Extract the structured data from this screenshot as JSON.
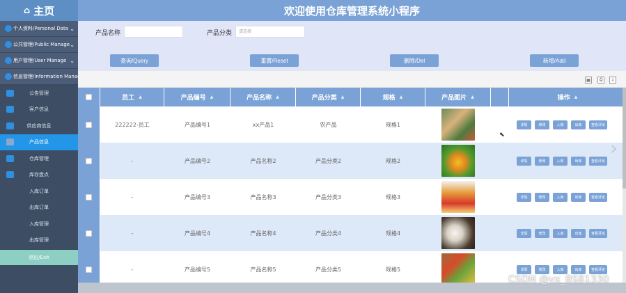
{
  "sidebar": {
    "home_label": "主页",
    "groups": [
      {
        "label": "个人资料/Personal Data"
      },
      {
        "label": "公共管理/Public Manage"
      },
      {
        "label": "用户管理/User Manage"
      },
      {
        "label": "信息管理/Information Manage"
      }
    ],
    "items": [
      {
        "label": "公告管理"
      },
      {
        "label": "客户信息"
      },
      {
        "label": "供应商信息"
      },
      {
        "label": "产品信息"
      },
      {
        "label": "仓库管理"
      },
      {
        "label": "库存盘点"
      },
      {
        "label": "入库订单"
      },
      {
        "label": "出库订单"
      },
      {
        "label": "入库管理"
      },
      {
        "label": "出库管理"
      }
    ],
    "logout_label": "退出/Exit"
  },
  "header": {
    "title": "欢迎使用仓库管理系统小程序"
  },
  "search": {
    "name_label": "产品名称",
    "name_value": "",
    "category_label": "产品分类",
    "category_placeholder": "请选择",
    "buttons": {
      "query": "查询/Query",
      "reset": "重置/Reset",
      "del": "删除/Del",
      "add": "新增/Add"
    }
  },
  "toolbar": {
    "icons": [
      "columns-icon",
      "print-icon",
      "export-icon"
    ]
  },
  "table": {
    "headers": {
      "employee": "员工",
      "code": "产品编号",
      "name": "产品名称",
      "category": "产品分类",
      "spec": "规格",
      "image": "产品图片",
      "ops": "操作"
    },
    "rows": [
      {
        "employee": "222222-员工",
        "code": "产品编号1",
        "name": "xx产品1",
        "category": "农产品",
        "spec": "规格1",
        "img": "vegetables",
        "actions": [
          "详情",
          "修改",
          "入库",
          "出库",
          "查看评论"
        ]
      },
      {
        "employee": "-",
        "code": "产品编号2",
        "name": "产品名称2",
        "category": "产品分类2",
        "spec": "规格2",
        "img": "corn",
        "actions": [
          "详情",
          "修改",
          "入库",
          "出库",
          "查看评论"
        ]
      },
      {
        "employee": "-",
        "code": "产品编号3",
        "name": "产品名称3",
        "category": "产品分类3",
        "spec": "规格3",
        "img": "package",
        "actions": [
          "详情",
          "修改",
          "入库",
          "出库",
          "查看评论"
        ]
      },
      {
        "employee": "-",
        "code": "产品编号4",
        "name": "产品名称4",
        "category": "产品分类4",
        "spec": "规格4",
        "img": "milk",
        "actions": [
          "详情",
          "修改",
          "入库",
          "出库",
          "查看评论"
        ]
      },
      {
        "employee": "-",
        "code": "产品编号5",
        "name": "产品名称5",
        "category": "产品分类5",
        "spec": "规格5",
        "img": "basket",
        "actions": [
          "详情",
          "修改",
          "入库",
          "出库",
          "查看评论"
        ]
      }
    ]
  },
  "watermark": "CSDN @vx_BS81330",
  "colors": {
    "accent": "#7aa2d6",
    "sidebar": "#3c4d64",
    "active": "#2496e8",
    "logout": "#8ecfc4"
  }
}
